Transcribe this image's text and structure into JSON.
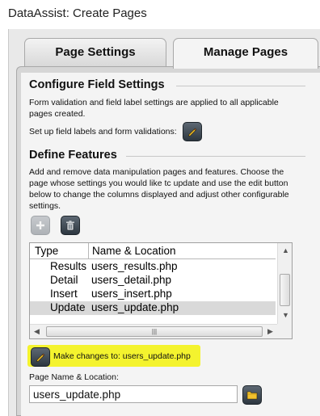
{
  "window": {
    "title": "DataAssist: Create Pages"
  },
  "tabs": [
    {
      "label": "Page Settings",
      "active": false
    },
    {
      "label": "Manage Pages",
      "active": true
    }
  ],
  "configure": {
    "heading": "Configure Field Settings",
    "description": "Form validation and field label settings are applied to all applicable pages created.",
    "setup_label": "Set up field labels and form validations:"
  },
  "features": {
    "heading": "Define Features",
    "description": "Add and remove data manipulation pages and features. Choose the page whose settings you would like tc update and use the edit button below to change the columns displayed and adjust other configurable settings.",
    "add_icon": "plus-icon",
    "delete_icon": "trash-icon",
    "columns": {
      "type": "Type",
      "name": "Name & Location"
    },
    "rows": [
      {
        "type": "Results",
        "name": "users_results.php",
        "selected": false
      },
      {
        "type": "Detail",
        "name": "users_detail.php",
        "selected": false
      },
      {
        "type": "Insert",
        "name": "users_insert.php",
        "selected": false
      },
      {
        "type": "Update",
        "name": "users_update.php",
        "selected": true
      }
    ],
    "make_changes_label": "Make changes to: users_update.php",
    "highlight_color": "#f4f32e"
  },
  "page_name": {
    "label": "Page Name & Location:",
    "value": "users_update.php",
    "browse_icon": "folder-icon"
  }
}
